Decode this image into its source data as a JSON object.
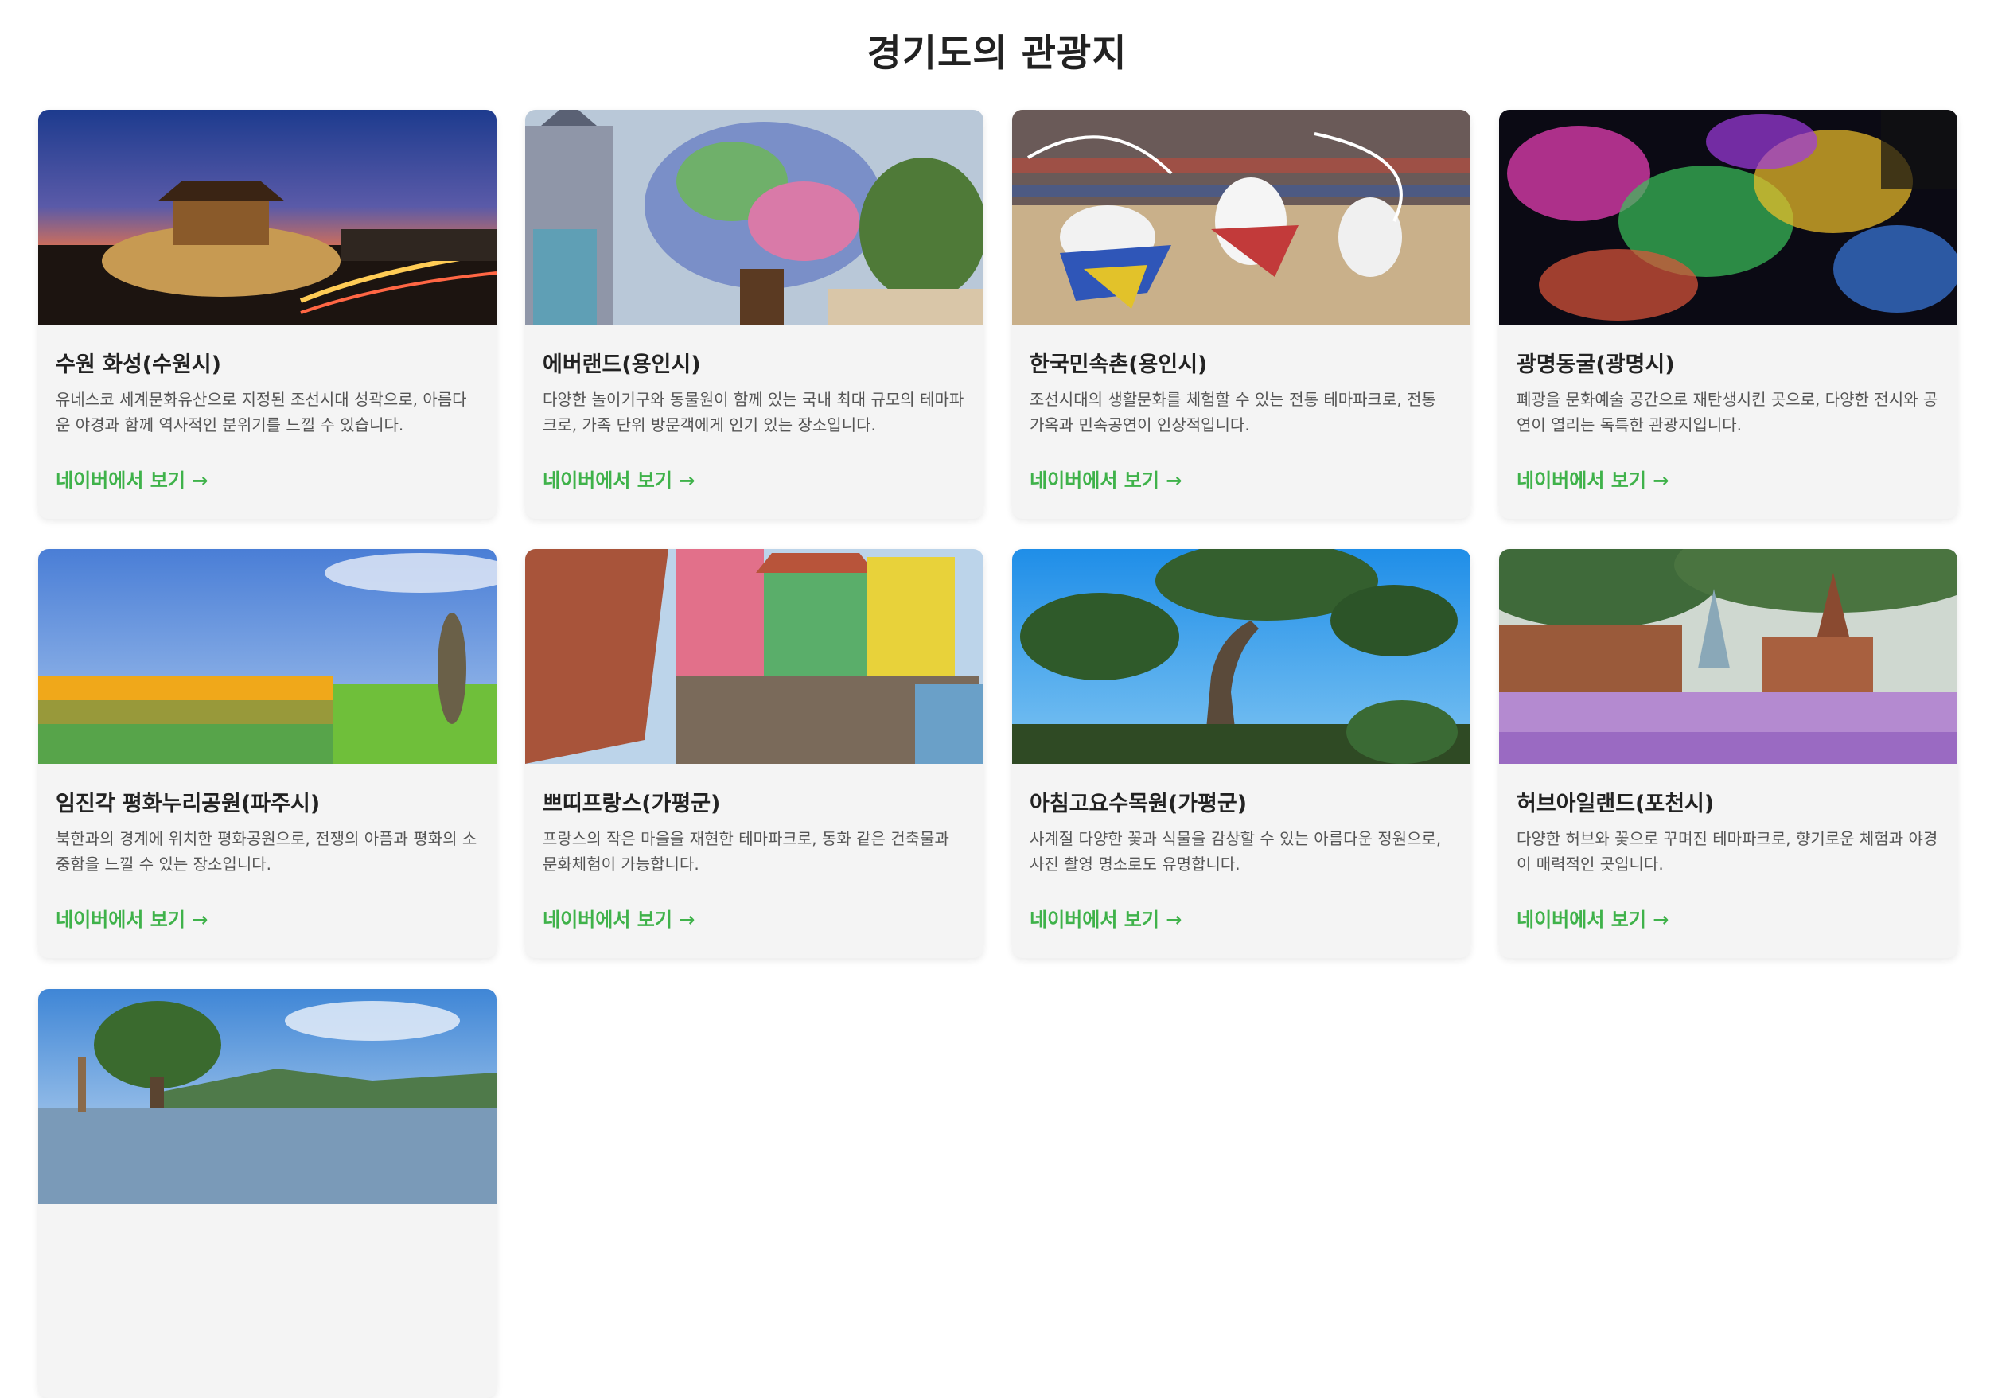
{
  "page": {
    "title": "경기도의 관광지"
  },
  "cards": [
    {
      "title": "수원 화성(수원시)",
      "desc": "유네스코 세계문화유산으로 지정된 조선시대 성곽으로, 아름다운 야경과 함께 역사적인 분위기를 느낄 수 있습니다.",
      "link": "네이버에서 보기 →",
      "image": "fortress-night-photo"
    },
    {
      "title": "에버랜드(용인시)",
      "desc": "다양한 놀이기구와 동물원이 함께 있는 국내 최대 규모의 테마파크로, 가족 단위 방문객에게 인기 있는 장소입니다.",
      "link": "네이버에서 보기 →",
      "image": "flower-tree-castle-photo"
    },
    {
      "title": "한국민속촌(용인시)",
      "desc": "조선시대의 생활문화를 체험할 수 있는 전통 테마파크로, 전통 가옥과 민속공연이 인상적입니다.",
      "link": "네이버에서 보기 →",
      "image": "folk-dance-performance-photo"
    },
    {
      "title": "광명동굴(광명시)",
      "desc": "폐광을 문화예술 공간으로 재탄생시킨 곳으로, 다양한 전시와 공연이 열리는 독특한 관광지입니다.",
      "link": "네이버에서 보기 →",
      "image": "cave-light-art-photo"
    },
    {
      "title": "임진각 평화누리공원(파주시)",
      "desc": "북한과의 경계에 위치한 평화공원으로, 전쟁의 아픔과 평화의 소중함을 느낄 수 있는 장소입니다.",
      "link": "네이버에서 보기 →",
      "image": "pinwheel-field-photo"
    },
    {
      "title": "쁘띠프랑스(가평군)",
      "desc": "프랑스의 작은 마을을 재현한 테마파크로, 동화 같은 건축물과 문화체험이 가능합니다.",
      "link": "네이버에서 보기 →",
      "image": "colorful-village-photo"
    },
    {
      "title": "아침고요수목원(가평군)",
      "desc": "사계절 다양한 꽃과 식물을 감상할 수 있는 아름다운 정원으로, 사진 촬영 명소로도 유명합니다.",
      "link": "네이버에서 보기 →",
      "image": "pine-tree-garden-photo"
    },
    {
      "title": "허브아일랜드(포천시)",
      "desc": "다양한 허브와 꽃으로 꾸며진 테마파크로, 향기로운 체험과 야경이 매력적인 곳입니다.",
      "link": "네이버에서 보기 →",
      "image": "lavender-church-photo"
    },
    {
      "title": "",
      "desc": "",
      "link": "",
      "image": "riverside-tree-photo"
    }
  ]
}
